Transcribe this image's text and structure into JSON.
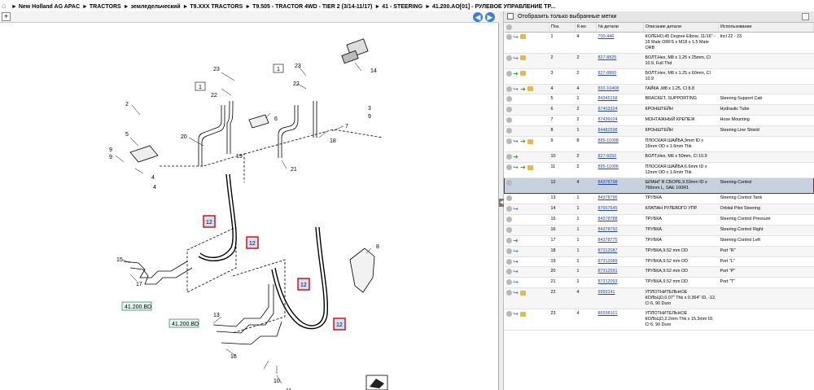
{
  "breadcrumb": {
    "items": [
      "New Holland AG APAC",
      "TRACTORS",
      "земледельческий",
      "T9.XXX TRACTORS",
      "T9.505 - TRACTOR 4WD - TIER 2 (3/14-11/17)",
      "41 - STEERING",
      "41.200.AO[01] - РУЛЕВОЕ УПРАВЛЕНИЕ ТР..."
    ]
  },
  "diagram": {
    "callouts": [
      "12",
      "12",
      "12",
      "12"
    ],
    "labels": [
      "1",
      "1",
      "2",
      "3",
      "4",
      "4",
      "5",
      "6",
      "7",
      "8",
      "9",
      "9",
      "9",
      "10",
      "11",
      "13",
      "14",
      "15",
      "16",
      "17",
      "18",
      "19",
      "20",
      "21",
      "22",
      "22",
      "23",
      "23"
    ],
    "refs": [
      "41.200.BD",
      "41.200.BD"
    ]
  },
  "filter": {
    "label": "Отобразить только выбранные метки"
  },
  "table": {
    "headers": [
      "",
      "Поз.",
      "К-во",
      "№ детали",
      "Описание детали",
      "Использование"
    ],
    "rows": [
      {
        "icons": [
          "info",
          "blue",
          "box"
        ],
        "pos": "1",
        "qty": "4",
        "part": "700-446",
        "desc": "КОЛЕНО,45 Degree Elbow, 11/16\" - 16 Male ORFS x M18 x 1.5 Male ORB",
        "use": "Incl 22 - 23"
      },
      {
        "icons": [
          "info",
          "blue",
          "box"
        ],
        "pos": "2",
        "qty": "2",
        "part": "827-8825",
        "desc": "БОЛТ,Hex, M8 x 1.25 x 25mm, Cl 10.9, Full Thd",
        "use": ""
      },
      {
        "icons": [
          "info",
          "green",
          "box"
        ],
        "pos": "3",
        "qty": "2",
        "part": "827-8860",
        "desc": "БОЛТ,Hex, M8 x 1.25 x 60mm, Cl 10.9",
        "use": ""
      },
      {
        "icons": [
          "info",
          "blue",
          "green",
          "box"
        ],
        "pos": "4",
        "qty": "4",
        "part": "832-10408",
        "desc": "ГАЙКА ,M8 x 1.25, Cl 8.8",
        "use": ""
      },
      {
        "icons": [
          "info"
        ],
        "pos": "5",
        "qty": "1",
        "part": "84345158",
        "desc": "BRACKET, SUPPORTING",
        "use": "Steering Support Cab"
      },
      {
        "icons": [
          "info"
        ],
        "pos": "6",
        "qty": "2",
        "part": "87403324",
        "desc": "КРОНШТЕЙН",
        "use": "Hydraulic Tube"
      },
      {
        "icons": [
          "info"
        ],
        "pos": "7",
        "qty": "2",
        "part": "87436024",
        "desc": "МОНТАЖНЫЙ КРЕПЕЖ",
        "use": "Hose Mounting"
      },
      {
        "icons": [
          "info"
        ],
        "pos": "8",
        "qty": "1",
        "part": "84482598",
        "desc": "КРОНШТЕЙН",
        "use": "Steering Line Shield"
      },
      {
        "icons": [
          "info",
          "blue",
          "green",
          "box"
        ],
        "pos": "9",
        "qty": "8",
        "part": "895-11008",
        "desc": "ПЛОСКАЯ ШАЙБА,9mm ID x 16mm OD x 1.6mm Thk",
        "use": ""
      },
      {
        "icons": [
          "info",
          "green"
        ],
        "pos": "10",
        "qty": "2",
        "part": "827-6050",
        "desc": "БОЛТ,Hex, M6 x 50mm, Cl 10.9",
        "use": ""
      },
      {
        "icons": [
          "info",
          "blue",
          "green",
          "box"
        ],
        "pos": "11",
        "qty": "2",
        "part": "895-11006",
        "desc": "ПЛОСКАЯ ШАЙБА,6.6mm ID x 12mm OD x 1.6mm Thk",
        "use": ""
      },
      {
        "icons": [
          "info"
        ],
        "pos": "12",
        "qty": "4",
        "part": "84378798",
        "desc": "ШЛАНГ В СБОРЕ,9.53mm ID x 766mm L, SAE 100R1",
        "use": "Steering Control",
        "selected": true
      },
      {
        "icons": [
          "info"
        ],
        "pos": "13",
        "qty": "1",
        "part": "84378796",
        "desc": "ТРУБКА",
        "use": "Steering Control Tank"
      },
      {
        "icons": [
          "info",
          "blue"
        ],
        "pos": "14",
        "qty": "1",
        "part": "87667645",
        "desc": "КЛАПАН РУЛЕВОГО УПР.",
        "use": "Orbital Pilot Steering"
      },
      {
        "icons": [
          "info"
        ],
        "pos": "15",
        "qty": "1",
        "part": "84378788",
        "desc": "ТРУБКА",
        "use": "Steering Control Pressure"
      },
      {
        "icons": [
          "info"
        ],
        "pos": "16",
        "qty": "1",
        "part": "84378792",
        "desc": "ТРУБКА",
        "use": "Steering Control Right"
      },
      {
        "icons": [
          "info",
          "green"
        ],
        "pos": "17",
        "qty": "1",
        "part": "84378775",
        "desc": "ТРУБКА",
        "use": "Steering Control Left"
      },
      {
        "icons": [
          "info",
          "blue"
        ],
        "pos": "18",
        "qty": "1",
        "part": "87312087",
        "desc": "ТРУБКА,9.52 mm OD",
        "use": "Port \"R\""
      },
      {
        "icons": [
          "info",
          "blue"
        ],
        "pos": "19",
        "qty": "1",
        "part": "87312089",
        "desc": "ТРУБКА,9.52 mm OD",
        "use": "Port \"L\""
      },
      {
        "icons": [
          "info",
          "blue"
        ],
        "pos": "20",
        "qty": "1",
        "part": "87312091",
        "desc": "ТРУБКА,9.52 mm OD",
        "use": "Port \"P\""
      },
      {
        "icons": [
          "info",
          "blue"
        ],
        "pos": "21",
        "qty": "1",
        "part": "87312093",
        "desc": "ТРУБКА,9.52 mm OD",
        "use": "Port \"T\""
      },
      {
        "icons": [
          "info",
          "blue",
          "box"
        ],
        "pos": "22",
        "qty": "4",
        "part": "9993141",
        "desc": "УПЛОТНИТЕЛЬНОЕ КОЛЬЦО,0.07\" Thk x 0.364\" ID, -12, Cl 6, 90 Duro",
        "use": ""
      },
      {
        "icons": [
          "info",
          "blue",
          "box"
        ],
        "pos": "23",
        "qty": "4",
        "part": "86598101",
        "desc": "УПЛОТНИТЕЛЬНОЕ КОЛЬЦО,2.2mm Thk x 15.3mm ID, Cl 6, 90 Duro",
        "use": ""
      }
    ]
  },
  "colors": {
    "selection_bg": "#c6d2de",
    "highlight": "#e00000",
    "link": "#2246b3",
    "nav_blue": "#3b7fd6"
  }
}
